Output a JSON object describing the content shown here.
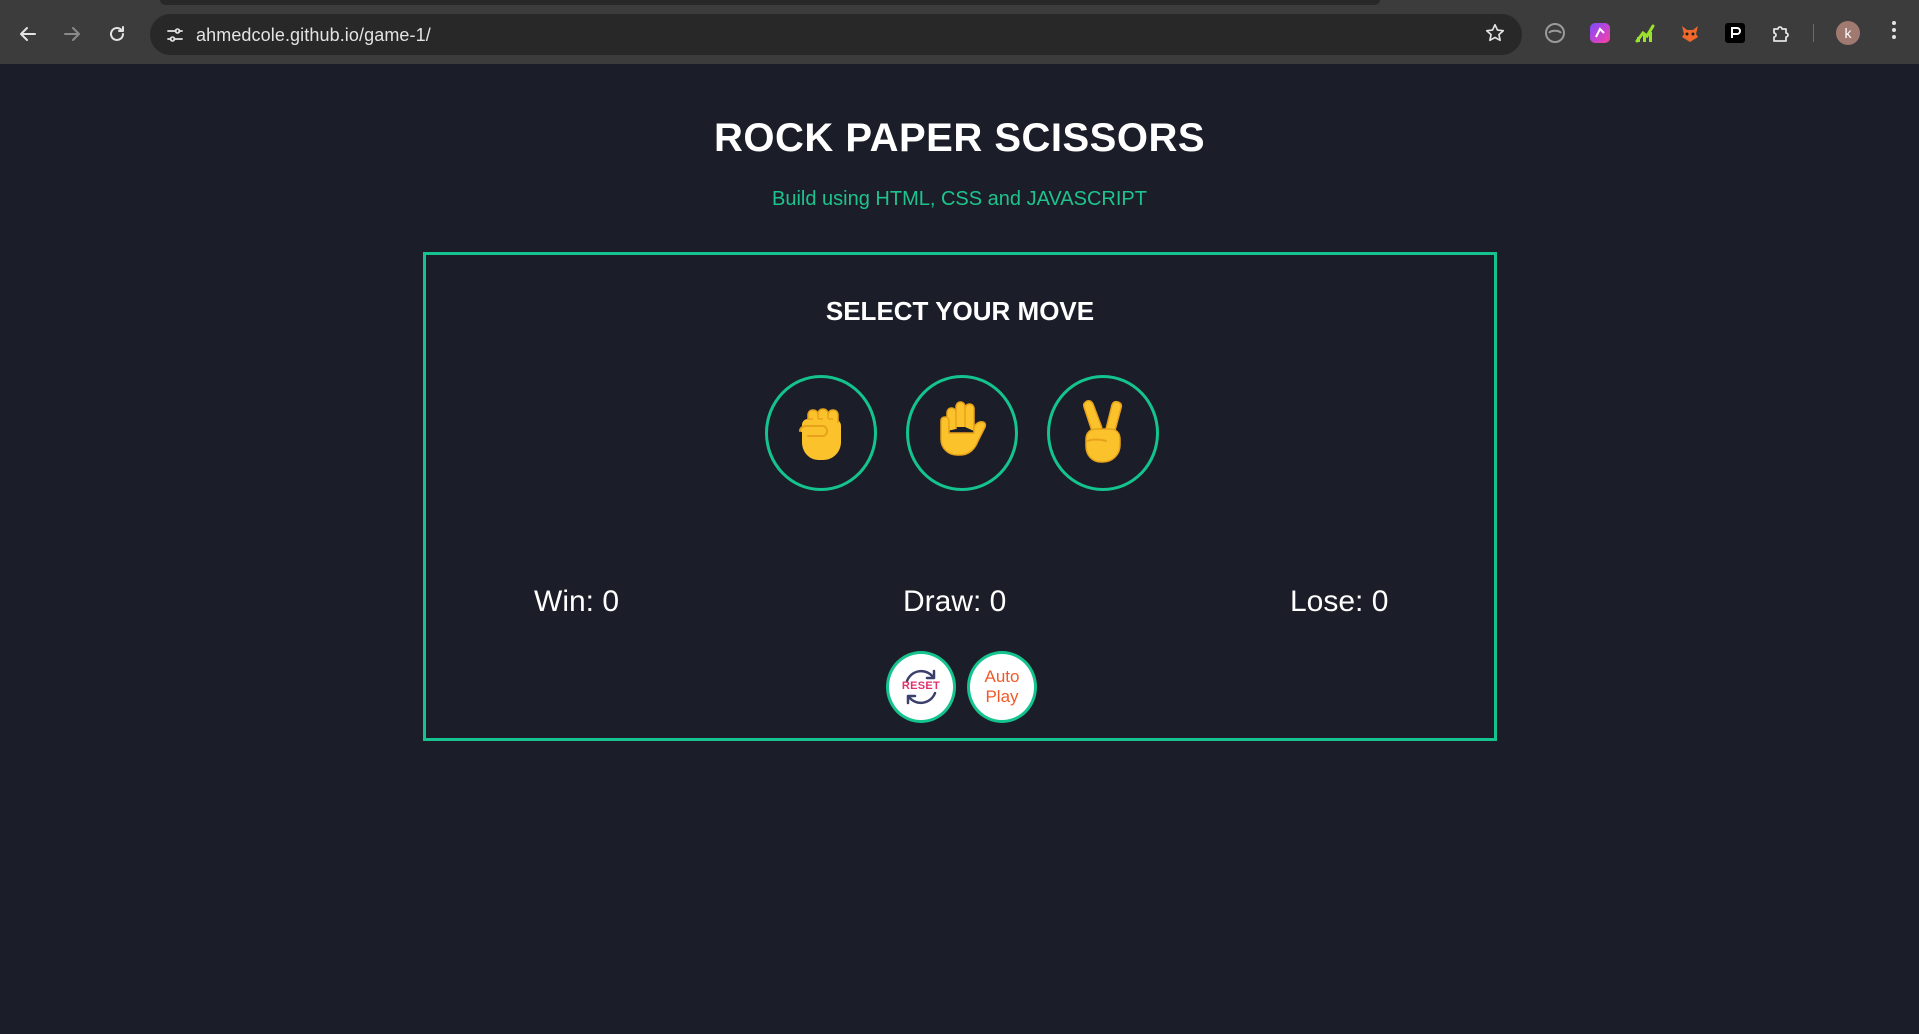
{
  "browser": {
    "url": "ahmedcole.github.io/game-1/",
    "profile_initial": "k",
    "icons": {
      "back": "back-arrow-icon",
      "forward": "forward-arrow-icon",
      "reload": "reload-icon",
      "site_info": "site-info-icon",
      "bookmark": "star-icon",
      "extensions": "puzzle-icon",
      "menu": "kebab-menu-icon"
    }
  },
  "game": {
    "title": "ROCK PAPER SCISSORS",
    "subtitle": "Build using HTML, CSS and JAVASCRIPT",
    "select_title": "SELECT YOUR MOVE",
    "moves": [
      {
        "name": "rock",
        "icon": "fist-icon"
      },
      {
        "name": "paper",
        "icon": "raised-hand-icon"
      },
      {
        "name": "scissors",
        "icon": "victory-hand-icon"
      }
    ],
    "scores": {
      "win": "Win: 0",
      "draw": "Draw: 0",
      "lose": "Lose: 0"
    },
    "reset_label": "RESET",
    "autoplay_label_line1": "Auto",
    "autoplay_label_line2": "Play"
  },
  "colors": {
    "background": "#1b1e28",
    "accent_green": "#14c38e",
    "subtitle_green": "#1ec38d",
    "hand_yellow": "#fcc22c",
    "autoplay_orange": "#f05a28",
    "reset_pink": "#e0336e"
  }
}
